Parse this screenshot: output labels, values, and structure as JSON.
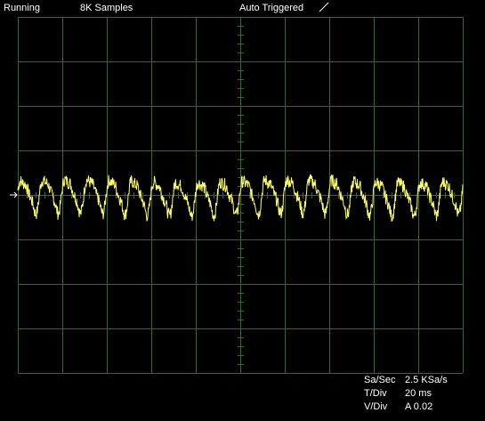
{
  "status": {
    "run_state": "Running",
    "samples": "8K Samples",
    "trigger_mode": "Auto Triggered",
    "trigger_slope_icon": "rising-edge-icon"
  },
  "grid": {
    "h_divisions": 10,
    "v_divisions": 8,
    "grid_color": "#2f6b2f",
    "trace_color": "#ffff66"
  },
  "readout": {
    "sample_rate_label": "Sa/Sec",
    "sample_rate_value": "2.5 KSa/s",
    "time_div_label": "T/Div",
    "time_div_value": "20 ms",
    "volt_div_label": "V/Div",
    "volt_div_value": "A 0.02"
  },
  "chart_data": {
    "type": "line",
    "x_unit": "div",
    "y_unit": "div",
    "xlim": [
      0,
      10
    ],
    "ylim": [
      -4,
      4
    ],
    "cycles_on_screen": 20,
    "amplitude_div": 0.42,
    "offset_div": 0.0,
    "ground_marker": "left-reference-arrow"
  }
}
